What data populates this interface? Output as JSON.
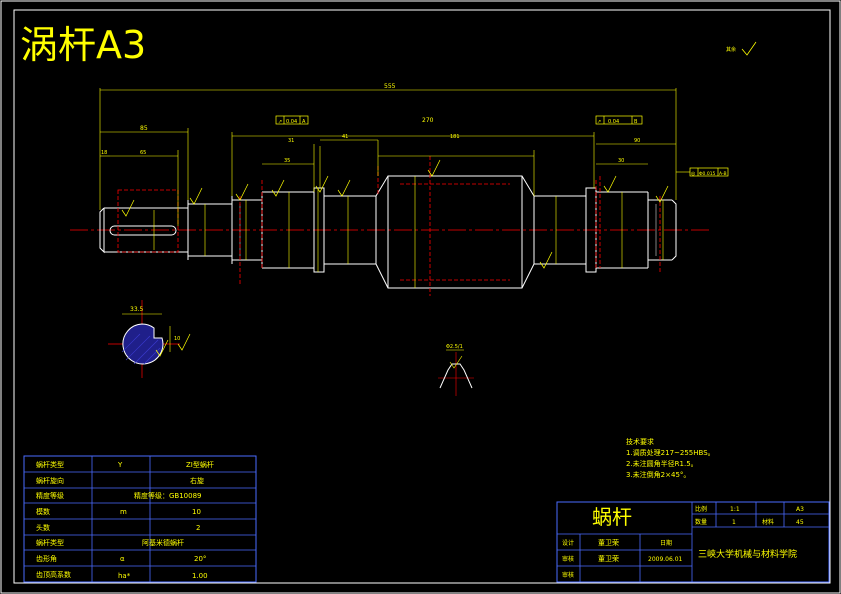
{
  "drawing_title": "涡杆A3",
  "surface_finish_note": "其余",
  "dimensions": {
    "overall_length": "555",
    "left_step": "85",
    "d18": "18",
    "d65": "65",
    "span_270": "270",
    "d35": "35",
    "d41": "41",
    "d181": "181",
    "d30": "30",
    "d31": "31",
    "d90": "90",
    "key_depth": "33.5",
    "key_width": "10",
    "tooth_callout": "Φ2.5/1"
  },
  "tolerance_frames": {
    "left": {
      "symbol": "↗",
      "value": "0.04",
      "datum": "A"
    },
    "right": {
      "symbol": "↗",
      "value": "0.04",
      "datum": "B"
    },
    "far_right": {
      "symbol": "◎",
      "value": "Φ0.015",
      "datum": "A-B"
    }
  },
  "technical_requirements": {
    "heading": "技术要求",
    "items": [
      "1.调质处理217~255HBS。",
      "2.未注圆角半径R1.5。",
      "3.未注倒角2×45°。"
    ]
  },
  "param_table": {
    "rows": [
      {
        "label": "蜗杆类型",
        "symbol": "Y",
        "value": "ZI型蜗杆"
      },
      {
        "label": "蜗杆旋向",
        "symbol": "",
        "value": "右旋"
      },
      {
        "label": "精度等级",
        "symbol": "",
        "value": "精度等级：GB10089"
      },
      {
        "label": "模数",
        "symbol": "m",
        "value": "10"
      },
      {
        "label": "头数",
        "symbol": "",
        "value": "2"
      },
      {
        "label": "蜗杆类型",
        "symbol": "",
        "value": "阿基米德蜗杆"
      },
      {
        "label": "齿形角",
        "symbol": "α",
        "value": "20°"
      },
      {
        "label": "齿顶高系数",
        "symbol": "ha*",
        "value": "1.00"
      }
    ]
  },
  "title_block": {
    "part_name": "蜗杆",
    "scale_label": "比例",
    "scale_value": "1:1",
    "sheet_label": "A3",
    "qty_label": "数量",
    "qty_value": "1",
    "material_label": "材料",
    "material_value": "45",
    "designer_label": "设计",
    "designer_name": "董卫荣",
    "date_label": "日期",
    "checker_label": "审核",
    "checker_name": "董卫荣",
    "date_value": "2009.06.01",
    "approver_label": "审核",
    "school": "三峡大学机械与材料学院"
  },
  "colors": {
    "background": "#000000",
    "frame": "#ffffff",
    "dimension": "#ffff00",
    "centerline": "#ff0000",
    "section_fill": "#3333aa",
    "table_lines": "#4a6bff"
  }
}
